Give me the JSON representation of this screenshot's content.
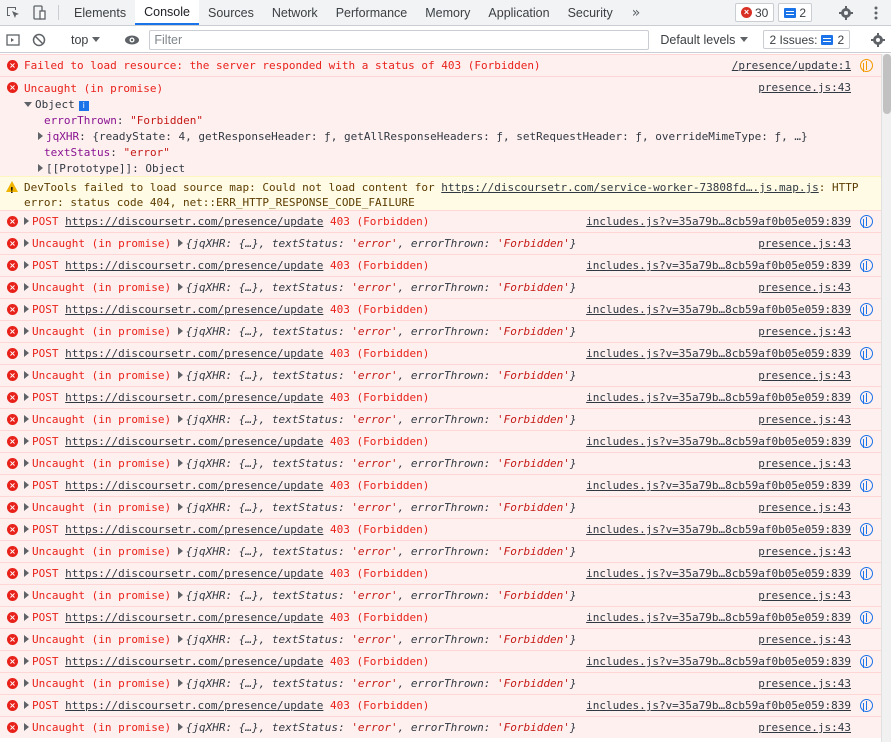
{
  "tabs": {
    "items": [
      "Elements",
      "Console",
      "Sources",
      "Network",
      "Performance",
      "Memory",
      "Application",
      "Security"
    ],
    "more": "»",
    "error_count": "30",
    "message_count": "2"
  },
  "toolbar": {
    "context": "top",
    "filter_placeholder": "Filter",
    "levels_label": "Default levels",
    "issues_label": "2 Issues:",
    "issues_count": "2"
  },
  "messages": {
    "m1": {
      "text": "Failed to load resource: the server responded with a status of 403 (Forbidden)",
      "source": "/presence/update:1"
    },
    "m2": {
      "text": "Uncaught (in promise)",
      "source": "presence.js:43",
      "object_label": "Object",
      "prop1_key": "errorThrown",
      "prop1_val": "\"Forbidden\"",
      "prop2_key": "jqXHR",
      "prop2_val": "{readyState: 4, getResponseHeader: ƒ, getAllResponseHeaders: ƒ, setRequestHeader: ƒ, overrideMimeType: ƒ, …}",
      "prop3_key": "textStatus",
      "prop3_val": "\"error\"",
      "proto": "[[Prototype]]: Object"
    },
    "warn": {
      "prefix": "DevTools failed to load source map: Could not load content for ",
      "url": "https://discoursetr.com/service-worker-73808fd….js.map.js",
      "suffix": ": HTTP",
      "line2": "error: status code 404, net::ERR_HTTP_RESPONSE_CODE_FAILURE"
    },
    "post": {
      "method": "POST",
      "url": "https://discoursetr.com/presence/update",
      "status": "403 (Forbidden)",
      "source": "includes.js?v=35a79b…8cb59af0b05e059:839"
    },
    "promise": {
      "prefix": "Uncaught (in promise)",
      "obj_open": "{",
      "k1": "jqXHR",
      "v1": "{…}",
      "k2": "textStatus",
      "v2": "'error'",
      "k3": "errorThrown",
      "v3": "'Forbidden'",
      "obj_close": "}",
      "source": "presence.js:43"
    }
  }
}
